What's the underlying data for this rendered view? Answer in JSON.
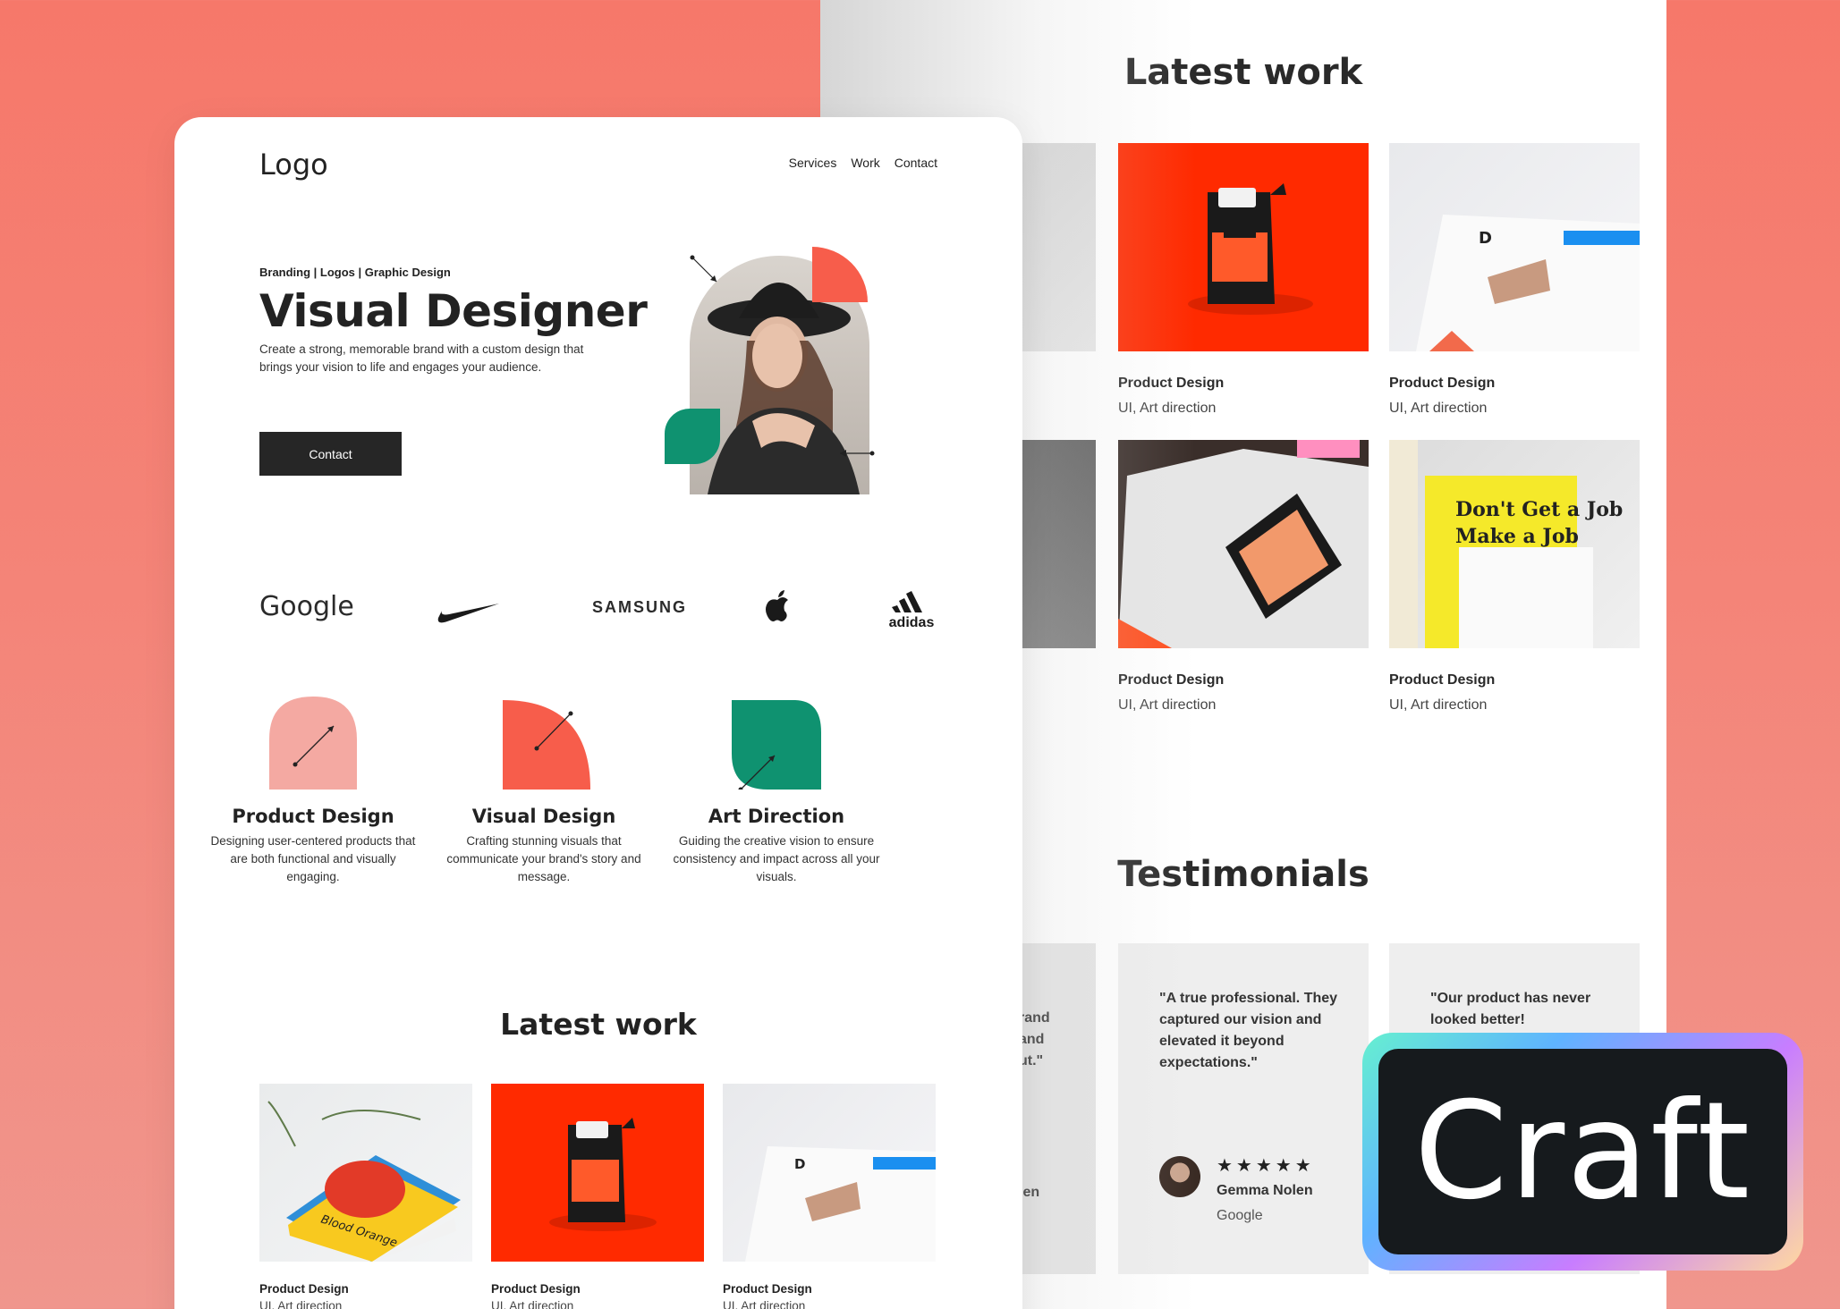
{
  "back_page": {
    "latest_title": "Latest work",
    "works": [
      {
        "title": "Product Design",
        "subtitle": "UI, Art direction"
      },
      {
        "title": "Product Design",
        "subtitle": "UI, Art direction"
      },
      {
        "title": "Product Design",
        "subtitle": "UI, Art direction"
      },
      {
        "title": "Product Design",
        "subtitle": "UI, Art direction"
      }
    ],
    "testimonials_title": "Testimonials",
    "ghost_text_1": "rand\nand\nut.\"",
    "ghost_name": "len",
    "testimonials": [
      {
        "quote": "\"A true professional. They captured our vision and elevated it beyond expectations.\"",
        "stars": "★★★★★",
        "name": "Gemma Nolen",
        "company": "Google"
      },
      {
        "quote": "\"Our product has never looked better!"
      }
    ]
  },
  "front_page": {
    "logo": "Logo",
    "nav": [
      "Services",
      "Work",
      "Contact"
    ],
    "tagline": "Branding | Logos | Graphic Design",
    "title": "Visual Designer",
    "description": "Create a strong, memorable brand with a custom design that brings your vision to life and engages your audience.",
    "cta": "Contact",
    "brands": [
      "Google",
      "nike-swoosh",
      "SAMSUNG",
      "apple-logo",
      "adidas"
    ],
    "services": [
      {
        "title": "Product Design",
        "desc": "Designing user-centered products that are both functional and visually engaging.",
        "color": "#f4a9a2"
      },
      {
        "title": "Visual Design",
        "desc": "Crafting stunning visuals that communicate your brand's story and message.",
        "color": "#f75d4b"
      },
      {
        "title": "Art Direction",
        "desc": "Guiding the creative vision to ensure consistency and impact across all your visuals.",
        "color": "#0f9270"
      }
    ],
    "latest_title": "Latest work",
    "works": [
      {
        "title": "Product Design",
        "subtitle": "UI, Art direction",
        "book_text": "Blood Orange"
      },
      {
        "title": "Product Design",
        "subtitle": "UI, Art direction"
      },
      {
        "title": "Product Design",
        "subtitle": "UI, Art direction"
      }
    ]
  },
  "badge": {
    "label": "Craft"
  },
  "colors": {
    "coral": "#f75d4b",
    "pink": "#f4a9a2",
    "green": "#0f9270",
    "dark": "#262626"
  }
}
